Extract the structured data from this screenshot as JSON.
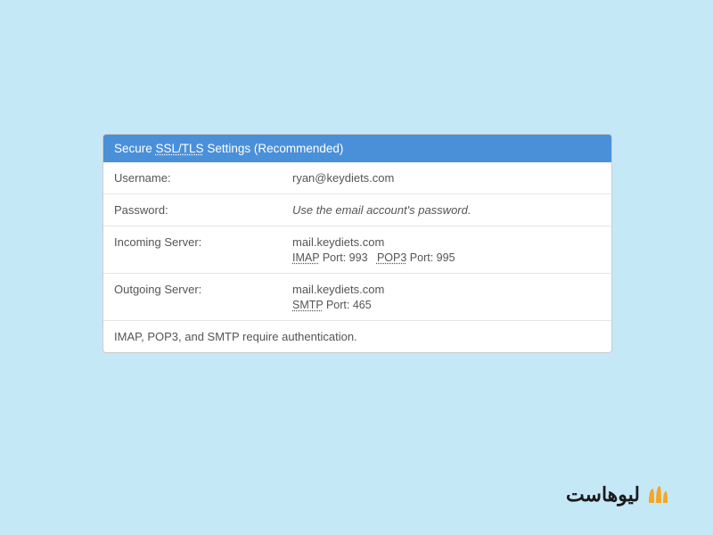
{
  "panel": {
    "header_prefix": "Secure ",
    "header_abbr": "SSL/TLS",
    "header_suffix": " Settings (Recommended)",
    "rows": {
      "username": {
        "label": "Username:",
        "value": "ryan@keydiets.com"
      },
      "password": {
        "label": "Password:",
        "value": "Use the email account's password."
      },
      "incoming": {
        "label": "Incoming Server:",
        "server": "mail.keydiets.com",
        "imap_abbr": "IMAP",
        "imap_port": " Port: 993",
        "pop3_abbr": "POP3",
        "pop3_port": " Port: 995"
      },
      "outgoing": {
        "label": "Outgoing Server:",
        "server": "mail.keydiets.com",
        "smtp_abbr": "SMTP",
        "smtp_port": " Port: 465"
      }
    },
    "footer": "IMAP, POP3, and SMTP require authentication."
  },
  "branding": {
    "text": "لیوهاست"
  }
}
